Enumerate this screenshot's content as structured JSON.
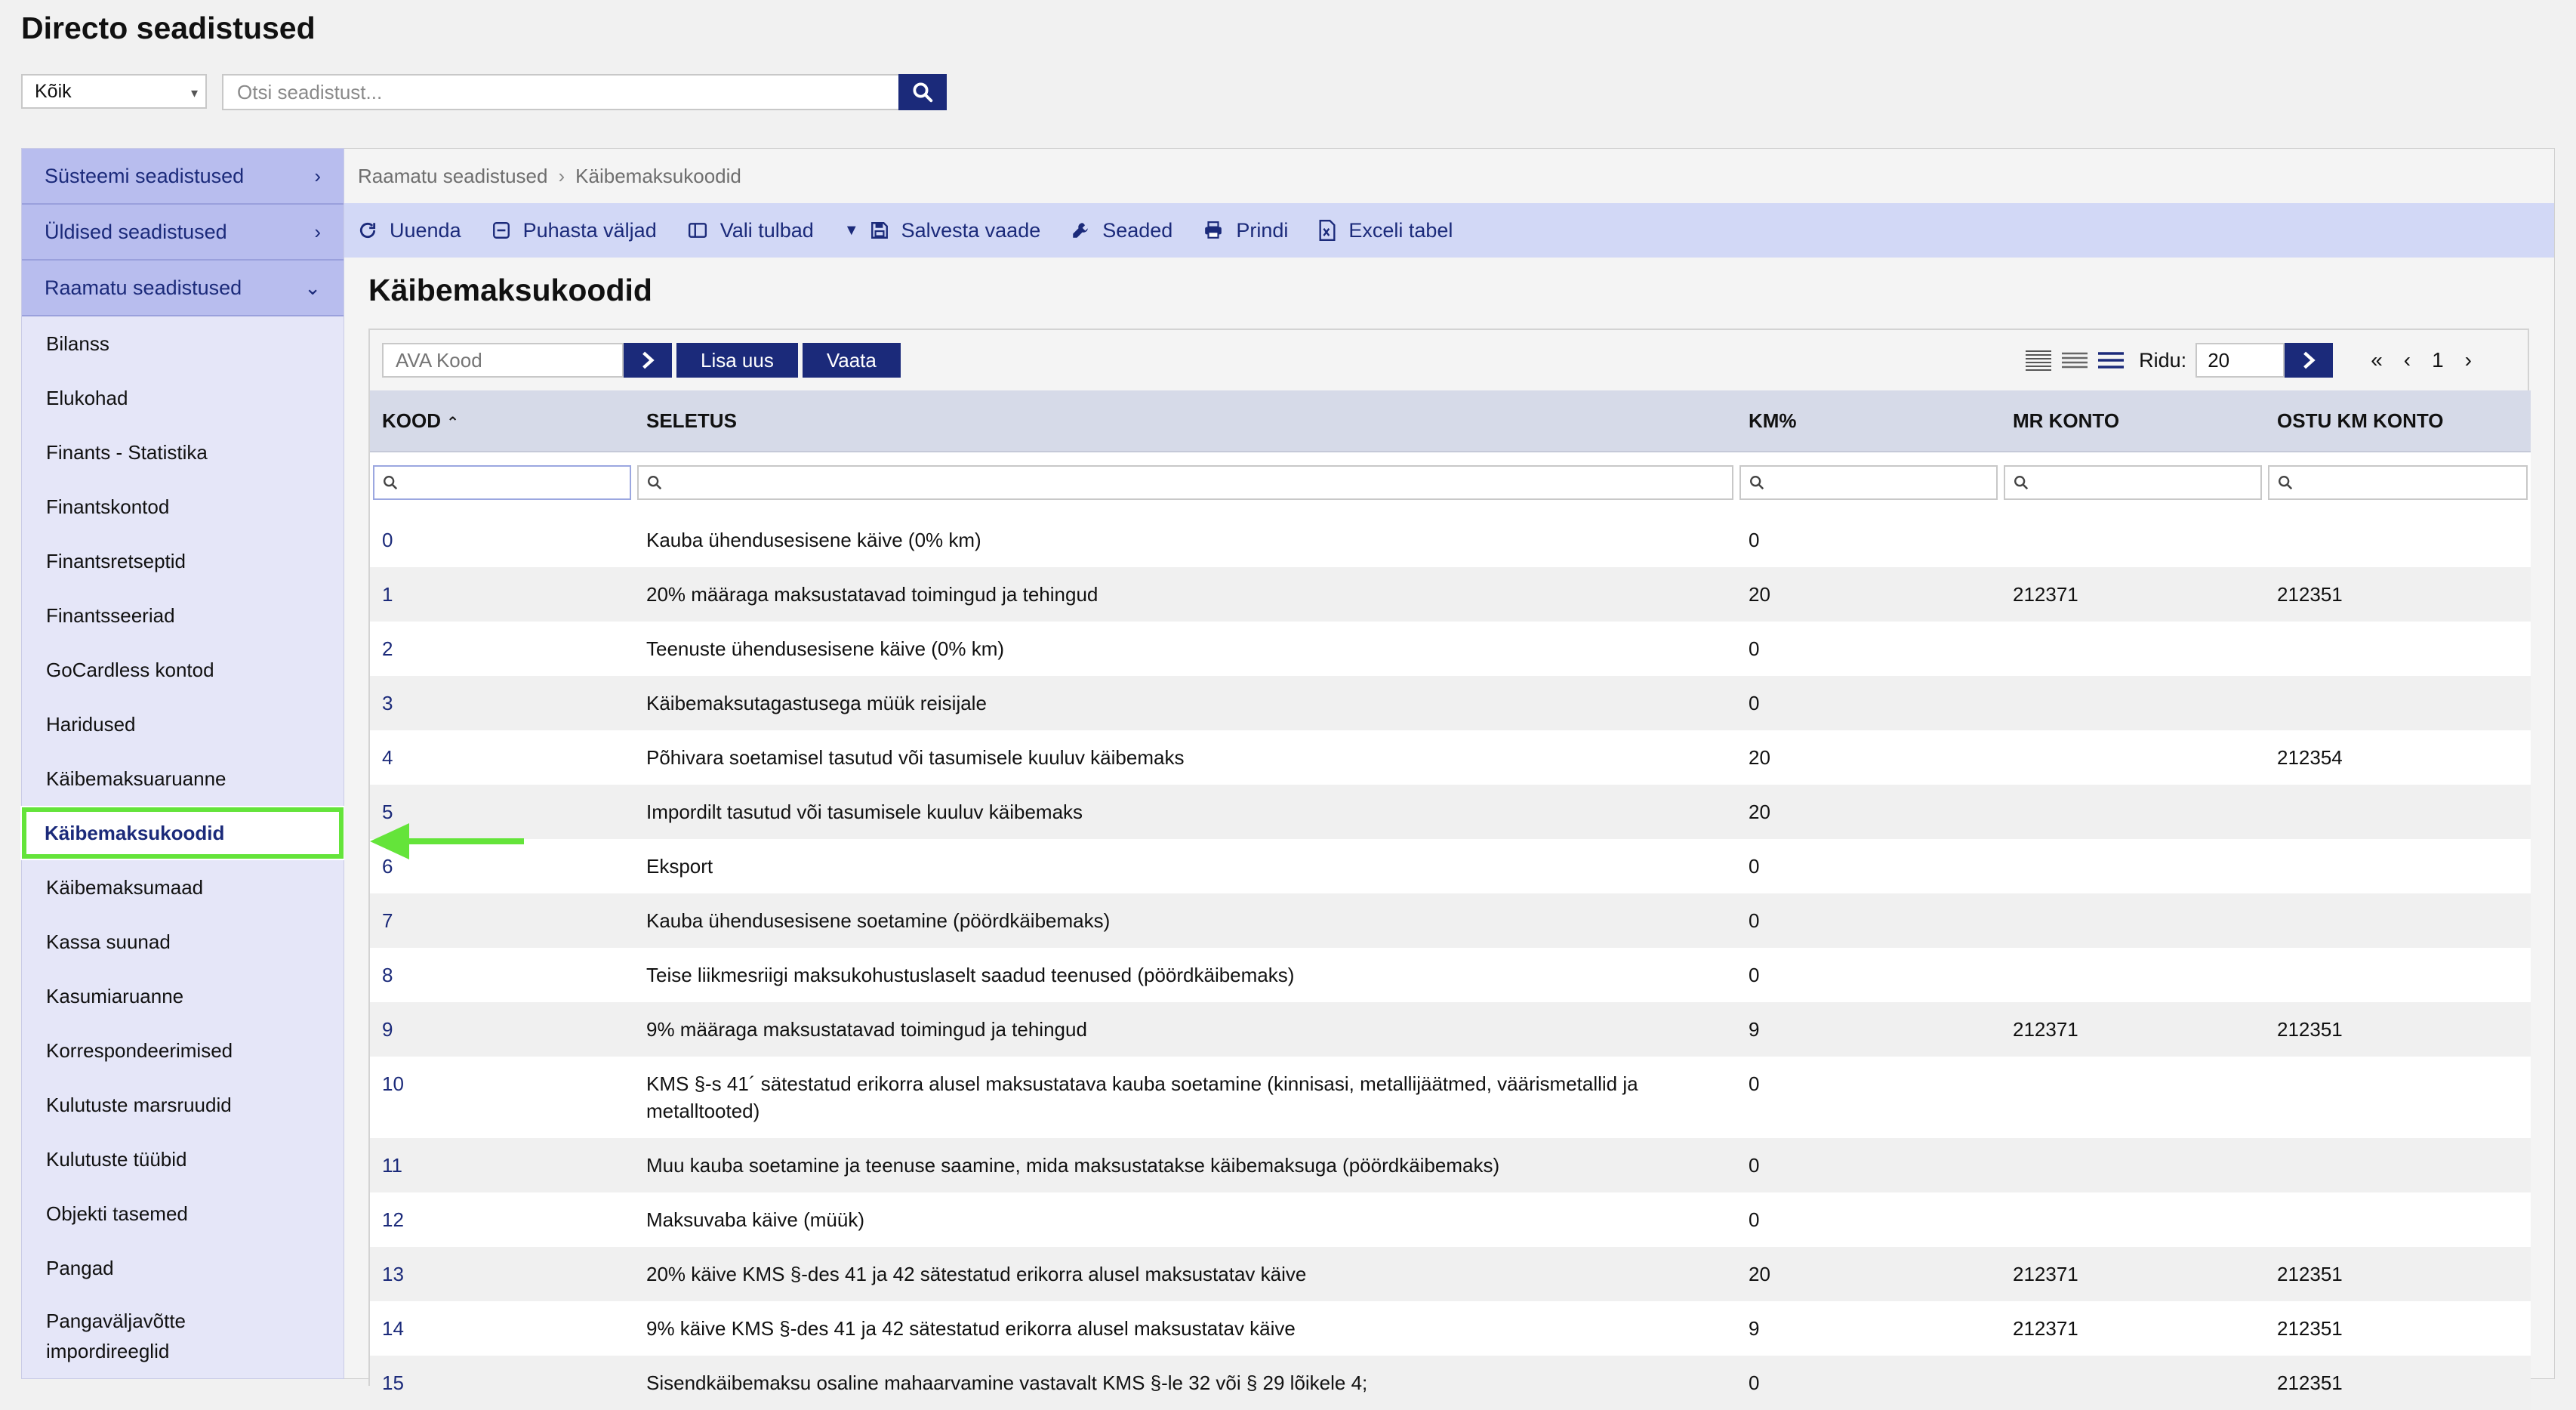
{
  "app": {
    "title": "Directo seadistused"
  },
  "filter": {
    "selected": "Kõik",
    "search_placeholder": "Otsi seadistust..."
  },
  "sidebar": {
    "sections": [
      {
        "label": "Süsteemi seadistused",
        "expanded": false
      },
      {
        "label": "Üldised seadistused",
        "expanded": false
      },
      {
        "label": "Raamatu seadistused",
        "expanded": true
      }
    ],
    "items": [
      {
        "label": "Bilanss"
      },
      {
        "label": "Elukohad"
      },
      {
        "label": "Finants - Statistika"
      },
      {
        "label": "Finantskontod"
      },
      {
        "label": "Finantsretseptid"
      },
      {
        "label": "Finantsseeriad"
      },
      {
        "label": "GoCardless kontod"
      },
      {
        "label": "Haridused"
      },
      {
        "label": "Käibemaksuaruanne"
      },
      {
        "label": "Käibemaksukoodid",
        "active": true
      },
      {
        "label": "Käibemaksumaad"
      },
      {
        "label": "Kassa suunad"
      },
      {
        "label": "Kasumiaruanne"
      },
      {
        "label": "Korrespondeerimised"
      },
      {
        "label": "Kulutuste marsruudid"
      },
      {
        "label": "Kulutuste tüübid"
      },
      {
        "label": "Objekti tasemed"
      },
      {
        "label": "Pangad"
      },
      {
        "label": "Pangaväljavõtte impordireeglid"
      }
    ]
  },
  "breadcrumb": {
    "parent": "Raamatu seadistused",
    "current": "Käibemaksukoodid"
  },
  "toolbar": {
    "refresh": "Uuenda",
    "clear": "Puhasta väljad",
    "columns": "Vali tulbad",
    "save_view": "Salvesta vaade",
    "settings": "Seaded",
    "print": "Prindi",
    "excel": "Exceli tabel"
  },
  "main": {
    "title": "Käibemaksukoodid",
    "ava_placeholder": "AVA Kood",
    "add_new": "Lisa uus",
    "view": "Vaata",
    "rows_label": "Ridu:",
    "rows_value": "20",
    "page": "1"
  },
  "table": {
    "headers": [
      "KOOD",
      "SELETUS",
      "KM%",
      "MR KONTO",
      "OSTU KM KONTO"
    ],
    "rows": [
      {
        "kood": "0",
        "seletus": "Kauba ühendusesisene käive (0% km)",
        "km": "0",
        "mr": "",
        "ostu": ""
      },
      {
        "kood": "1",
        "seletus": "20% määraga maksustatavad toimingud ja tehingud",
        "km": "20",
        "mr": "212371",
        "ostu": "212351"
      },
      {
        "kood": "2",
        "seletus": "Teenuste ühendusesisene käive (0% km)",
        "km": "0",
        "mr": "",
        "ostu": ""
      },
      {
        "kood": "3",
        "seletus": "Käibemaksutagastusega müük reisijale",
        "km": "0",
        "mr": "",
        "ostu": ""
      },
      {
        "kood": "4",
        "seletus": "Põhivara soetamisel tasutud või tasumisele kuuluv käibemaks",
        "km": "20",
        "mr": "",
        "ostu": "212354"
      },
      {
        "kood": "5",
        "seletus": "Impordilt tasutud või tasumisele kuuluv käibemaks",
        "km": "20",
        "mr": "",
        "ostu": ""
      },
      {
        "kood": "6",
        "seletus": "Eksport",
        "km": "0",
        "mr": "",
        "ostu": ""
      },
      {
        "kood": "7",
        "seletus": "Kauba ühendusesisene soetamine (pöördkäibemaks)",
        "km": "0",
        "mr": "",
        "ostu": ""
      },
      {
        "kood": "8",
        "seletus": "Teise liikmesriigi maksukohustuslaselt saadud teenused (pöördkäibemaks)",
        "km": "0",
        "mr": "",
        "ostu": ""
      },
      {
        "kood": "9",
        "seletus": "9% määraga maksustatavad toimingud ja tehingud",
        "km": "9",
        "mr": "212371",
        "ostu": "212351"
      },
      {
        "kood": "10",
        "seletus": "KMS §-s 41´ sätestatud erikorra alusel maksustatava kauba soetamine (kinnisasi, metallijäätmed, väärismetallid ja metalltooted)",
        "km": "0",
        "mr": "",
        "ostu": ""
      },
      {
        "kood": "11",
        "seletus": "Muu kauba soetamine ja teenuse saamine, mida maksustatakse käibemaksuga (pöördkäibemaks)",
        "km": "0",
        "mr": "",
        "ostu": ""
      },
      {
        "kood": "12",
        "seletus": "Maksuvaba käive (müük)",
        "km": "0",
        "mr": "",
        "ostu": ""
      },
      {
        "kood": "13",
        "seletus": "20% käive KMS §-des 41 ja 42 sätestatud erikorra alusel maksustatav käive",
        "km": "20",
        "mr": "212371",
        "ostu": "212351"
      },
      {
        "kood": "14",
        "seletus": "9% käive KMS §-des 41 ja 42 sätestatud erikorra alusel maksustatav käive",
        "km": "9",
        "mr": "212371",
        "ostu": "212351"
      },
      {
        "kood": "15",
        "seletus": "Sisendkäibemaksu osaline mahaarvamine vastavalt KMS §-le 32 või § 29 lõikele 4;",
        "km": "0",
        "mr": "",
        "ostu": "212351"
      }
    ]
  },
  "colors": {
    "brand": "#1b2a7a",
    "sidebar_section": "#b8bdee",
    "toolbar": "#d2d8f6",
    "highlight": "#64e43a"
  }
}
